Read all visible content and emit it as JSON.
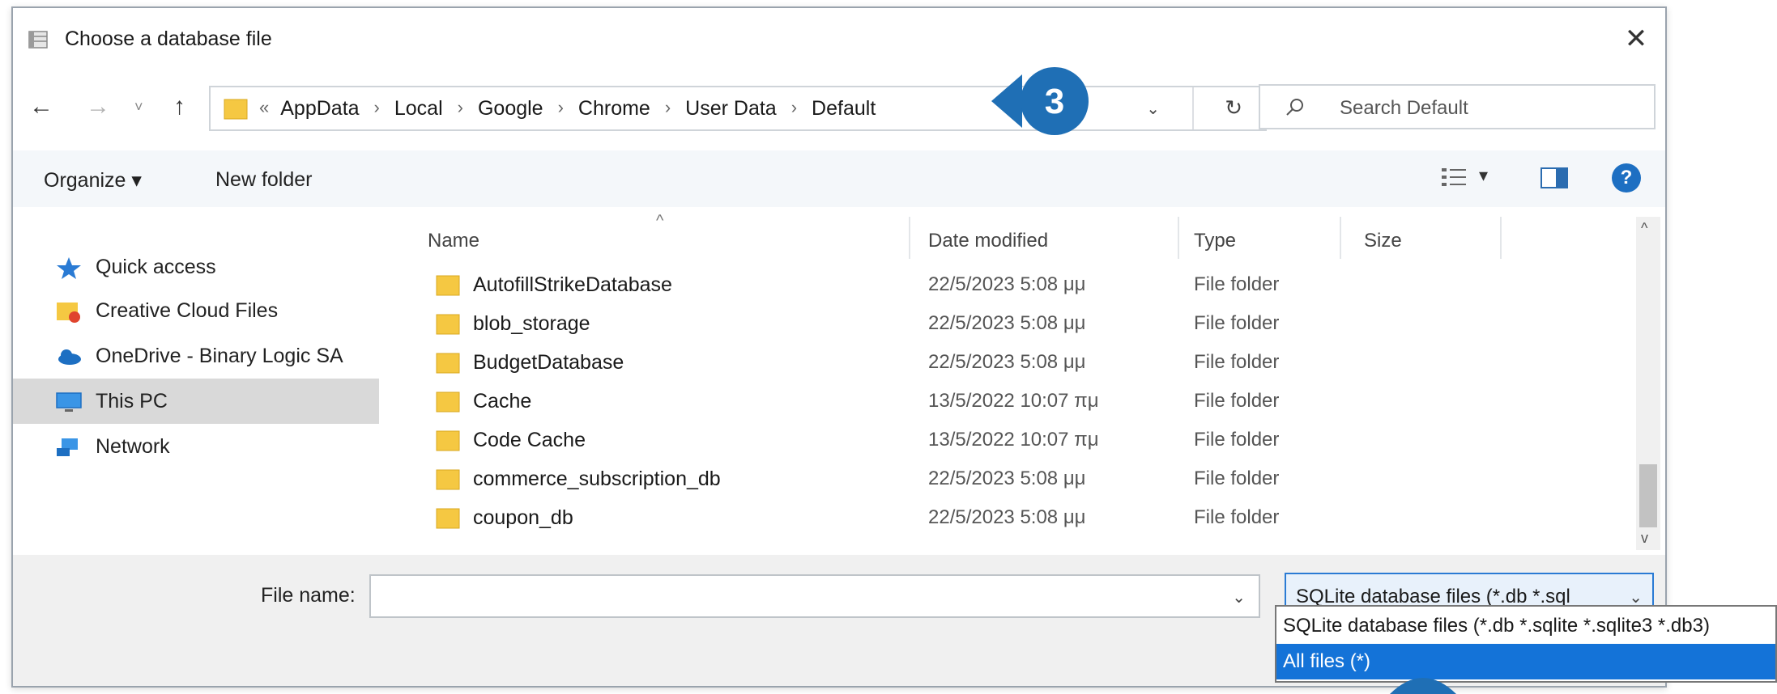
{
  "window": {
    "title": "Choose a database file",
    "close_label": "✕"
  },
  "nav": {
    "back": "←",
    "forward": "→",
    "recent": "˅",
    "up": "↑",
    "breadcrumb_lead": "«",
    "breadcrumb": [
      "AppData",
      "Local",
      "Google",
      "Chrome",
      "User Data",
      "Default"
    ],
    "separator": "›",
    "dropdown": "⌄",
    "refresh": "↻"
  },
  "step_badge": "3",
  "search": {
    "placeholder": "Search Default"
  },
  "toolbar": {
    "organize": "Organize ▾",
    "new_folder": "New folder",
    "view_caret": "▾",
    "help": "?"
  },
  "sidebar": {
    "items": [
      {
        "label": "Quick access",
        "icon": "star-icon"
      },
      {
        "label": "Creative Cloud Files",
        "icon": "creative-cloud-folder-icon"
      },
      {
        "label": "OneDrive - Binary Logic SA",
        "icon": "cloud-icon"
      },
      {
        "label": "This PC",
        "icon": "monitor-icon",
        "active": true
      },
      {
        "label": "Network",
        "icon": "network-icon"
      }
    ]
  },
  "columns": {
    "name": "Name",
    "date": "Date modified",
    "type": "Type",
    "size": "Size",
    "sort_indicator": "^"
  },
  "files": [
    {
      "name": "AutofillStrikeDatabase",
      "date": "22/5/2023 5:08 μμ",
      "type": "File folder"
    },
    {
      "name": "blob_storage",
      "date": "22/5/2023 5:08 μμ",
      "type": "File folder"
    },
    {
      "name": "BudgetDatabase",
      "date": "22/5/2023 5:08 μμ",
      "type": "File folder"
    },
    {
      "name": "Cache",
      "date": "13/5/2022 10:07 πμ",
      "type": "File folder"
    },
    {
      "name": "Code Cache",
      "date": "13/5/2022 10:07 πμ",
      "type": "File folder"
    },
    {
      "name": "commerce_subscription_db",
      "date": "22/5/2023 5:08 μμ",
      "type": "File folder"
    },
    {
      "name": "coupon_db",
      "date": "22/5/2023 5:08 μμ",
      "type": "File folder"
    }
  ],
  "scroll": {
    "up": "^",
    "down": "v"
  },
  "bottom": {
    "file_name_label": "File name:",
    "file_name_value": "",
    "file_name_dropdown": "⌄",
    "file_type_selected": "SQLite database files (*.db *.sql",
    "file_type_dropdown": "⌄",
    "file_type_options": [
      "SQLite database files (*.db *.sqlite *.sqlite3 *.db3)",
      "All files (*)"
    ]
  },
  "colors": {
    "accent": "#1473d8",
    "badge": "#1f6fb5",
    "folder": "#f5c842",
    "active_sidebar": "#d9d9d9"
  }
}
